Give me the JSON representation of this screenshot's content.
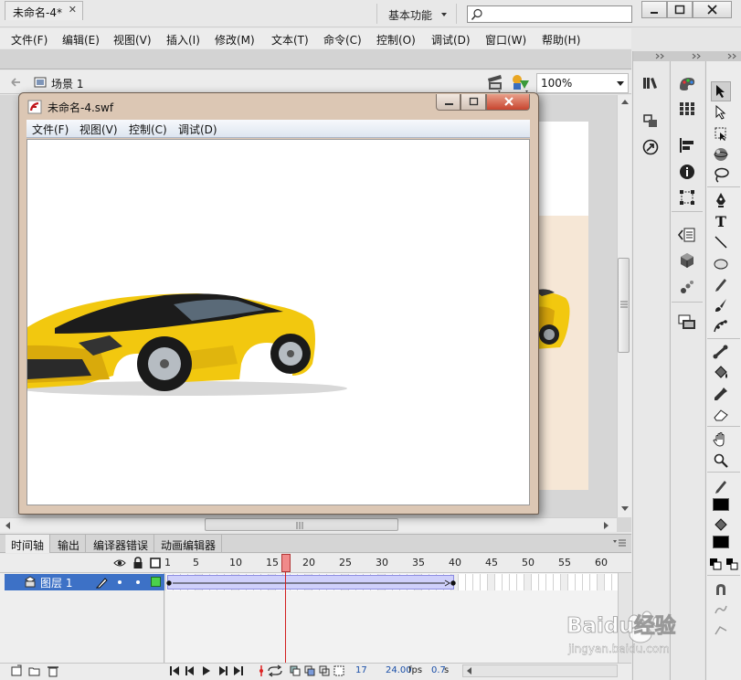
{
  "app": {
    "logo": "Fl",
    "workspace": "基本功能",
    "search_placeholder": ""
  },
  "menu": [
    "文件(F)",
    "编辑(E)",
    "视图(V)",
    "插入(I)",
    "修改(M)",
    "文本(T)",
    "命令(C)",
    "控制(O)",
    "调试(D)",
    "窗口(W)",
    "帮助(H)"
  ],
  "document": {
    "tab_title": "未命名-4*",
    "scene": "场景 1",
    "zoom": "100%"
  },
  "swf_window": {
    "title": "未命名-4.swf",
    "menu": [
      "文件(F)",
      "视图(V)",
      "控制(C)",
      "调试(D)"
    ]
  },
  "timeline": {
    "tabs": [
      "时间轴",
      "输出",
      "编译器错误",
      "动画编辑器"
    ],
    "frame_numbers": [
      "1",
      "5",
      "10",
      "15",
      "20",
      "25",
      "30",
      "35",
      "40",
      "45",
      "50",
      "55",
      "60"
    ],
    "layer_name": "图层 1",
    "current_frame": "17",
    "fps": "24.00",
    "fps_unit": "fps",
    "elapsed": "0.7",
    "elapsed_unit": "s"
  },
  "watermark": {
    "brand": "Baidu经验",
    "url": "jingyan.baidu.com"
  },
  "colors": {
    "layer_selected": "#3d71c6",
    "playhead": "#f08a8a",
    "tween": "#cfd0fb",
    "car_yellow": "#f2c80f"
  }
}
